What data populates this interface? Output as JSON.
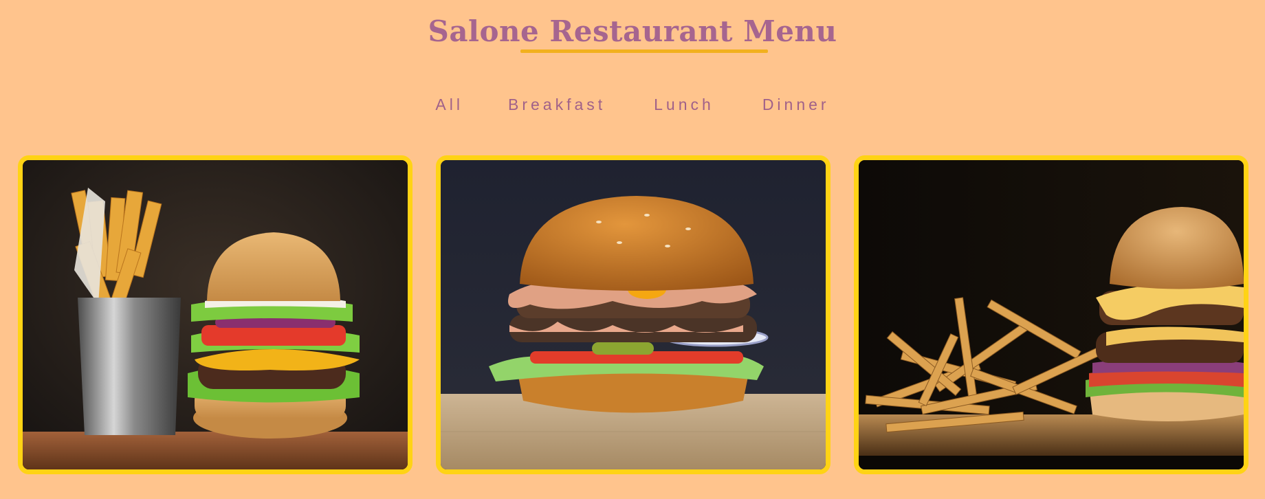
{
  "header": {
    "title": "Salone Restaurant Menu"
  },
  "filters": [
    {
      "label": "All"
    },
    {
      "label": "Breakfast"
    },
    {
      "label": "Lunch"
    },
    {
      "label": "Dinner"
    }
  ],
  "menu_items": [
    {
      "image": "burger-and-fries-in-steel-cup"
    },
    {
      "image": "double-cheeseburger"
    },
    {
      "image": "burger-with-fries-on-board"
    }
  ],
  "colors": {
    "background": "#FFC48D",
    "title": "#A6658F",
    "underline": "#F2B01E",
    "card_border": "#FFD315",
    "filter_text": "#A06189"
  }
}
